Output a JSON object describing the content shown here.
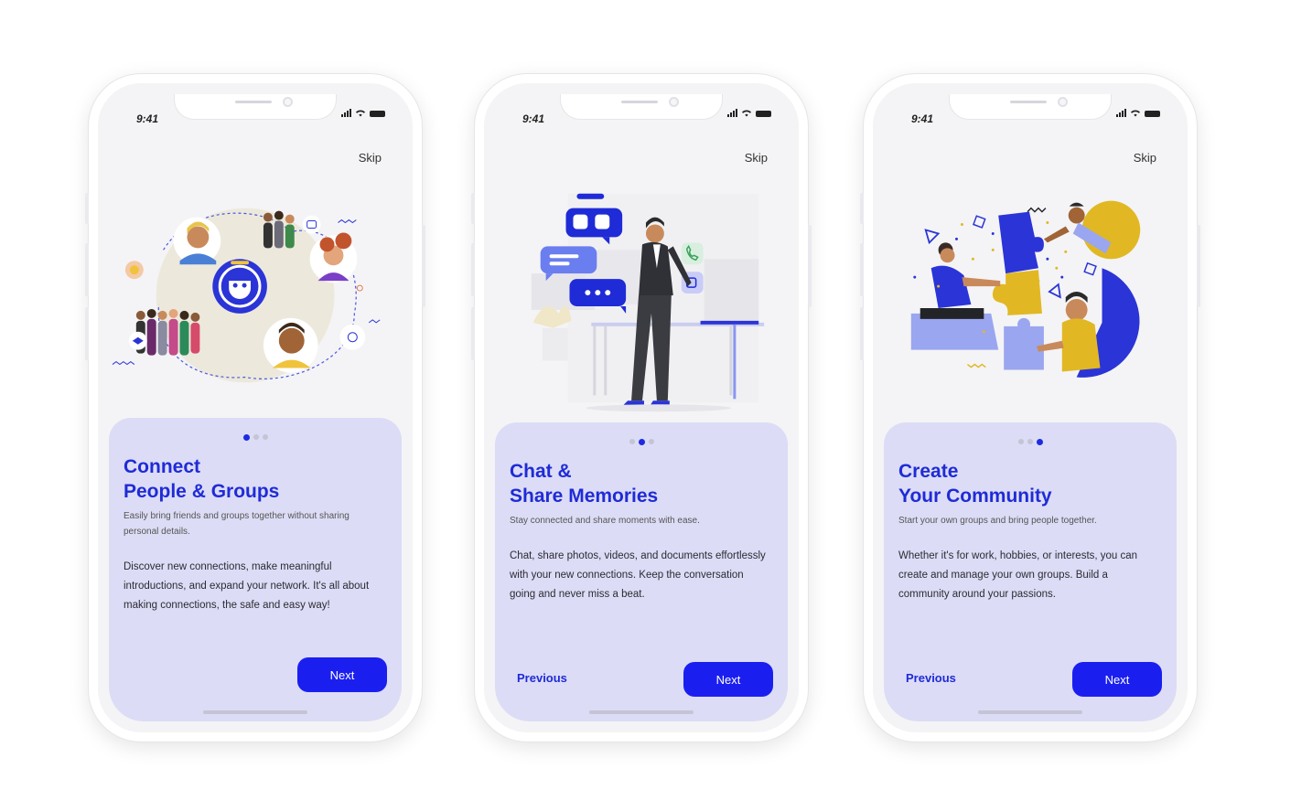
{
  "status": {
    "time": "9:41"
  },
  "colors": {
    "accent": "#1a1ff0",
    "card": "#dcdcf6",
    "title": "#1f2bd6",
    "yellow": "#e1b824"
  },
  "screens": [
    {
      "skip": "Skip",
      "title_line1": "Connect",
      "title_line2": "People & Groups",
      "subtitle": "Easily bring friends and groups together without sharing personal details.",
      "body": "Discover new connections, make meaningful introductions, and expand your network. It's all about making connections, the safe and easy way!",
      "next": "Next",
      "active_dot": 1,
      "illustration": "people-network-illustration"
    },
    {
      "skip": "Skip",
      "title_line1": "Chat &",
      "title_line2": "Share Memories",
      "subtitle": "Stay connected and share moments with ease.",
      "body": "Chat, share photos, videos, and documents effortlessly with your new connections. Keep the conversation going and never miss a beat.",
      "previous": "Previous",
      "next": "Next",
      "active_dot": 2,
      "illustration": "chat-messaging-illustration"
    },
    {
      "skip": "Skip",
      "title_line1": "Create",
      "title_line2": "Your Community",
      "subtitle": "Start your own groups and bring people together.",
      "body": "Whether it's for work, hobbies, or interests, you can create and manage your own groups. Build a community around your passions.",
      "previous": "Previous",
      "next": "Next",
      "active_dot": 3,
      "illustration": "puzzle-community-illustration"
    }
  ]
}
